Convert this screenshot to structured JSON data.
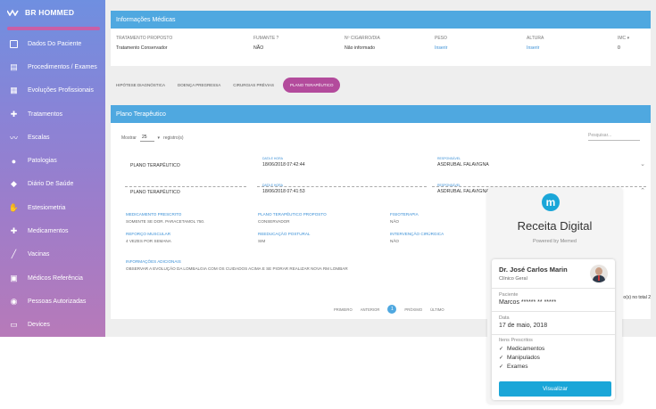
{
  "brand": {
    "name": "BR HOMMED"
  },
  "sidebar": {
    "items": [
      {
        "label": "Dados Do Paciente",
        "icon": "id-card-icon"
      },
      {
        "label": "Procedimentos / Exames",
        "icon": "file-icon"
      },
      {
        "label": "Evoluções Profissionais",
        "icon": "notes-icon"
      },
      {
        "label": "Tratamentos",
        "icon": "bandage-icon"
      },
      {
        "label": "Escalas",
        "icon": "trend-icon"
      },
      {
        "label": "Patologias",
        "icon": "pills-icon"
      },
      {
        "label": "Diário De Saúde",
        "icon": "tag-icon"
      },
      {
        "label": "Estesiometria",
        "icon": "hand-icon"
      },
      {
        "label": "Medicamentos",
        "icon": "bandage-icon"
      },
      {
        "label": "Vacinas",
        "icon": "syringe-icon"
      },
      {
        "label": "Médicos Referência",
        "icon": "badge-icon"
      },
      {
        "label": "Pessoas Autorizadas",
        "icon": "person-icon"
      },
      {
        "label": "Devices",
        "icon": "devices-icon"
      }
    ]
  },
  "info": {
    "title": "Informações Médicas",
    "cols": [
      {
        "label": "TRATAMENTO PROPOSTO",
        "value": "Tratamento Conservador",
        "link": false
      },
      {
        "label": "FUMANTE ?",
        "value": "NÃO",
        "link": false
      },
      {
        "label": "Nº CIGARRO/DIA",
        "value": "Não informado",
        "link": false
      },
      {
        "label": "PESO",
        "value": "Inserir",
        "link": true
      },
      {
        "label": "ALTURA",
        "value": "Inserir",
        "link": true
      },
      {
        "label": "IMC",
        "value": "0",
        "link": false
      }
    ]
  },
  "tabs": [
    "HIPÓTESE DIAGNÓSTICA",
    "DOENÇA PREGRESSA",
    "CIRURGIAS PRÉVIAS",
    "PLANO TERAPÊUTICO"
  ],
  "plan": {
    "title": "Plano Terapêutico",
    "show_prefix": "Mostrar",
    "page_size": "25",
    "show_suffix": "registro(s)",
    "search_placeholder": "Pesquisar...",
    "rows": [
      {
        "title": "PLANO TERAPÊUTICO",
        "date_label": "DATA E HORA",
        "date": "18/06/2018 07:42:44",
        "resp_label": "RESPONSÁVEL",
        "resp": "ASDRUBAL FALAVIGNA",
        "chevron": "⌄"
      },
      {
        "title": "PLANO TERAPÊUTICO",
        "date_label": "DATA E HORA",
        "date": "18/06/2018 07:41:53",
        "resp_label": "RESPONSÁVEL",
        "resp": "ASDRUBAL FALAVIGNA",
        "chevron": "⌃"
      }
    ],
    "details": [
      {
        "label": "MEDICAMENTO PRESCRITO",
        "value": "SOMENTE SE DOR. PARACETAMOL 750."
      },
      {
        "label": "PLANO TERAPÊUTICO PROPOSTO",
        "value": "CONSERVADOR"
      },
      {
        "label": "FISIOTERAPIA",
        "value": "NÃO"
      },
      {
        "label": "REFORÇO MUSCULAR",
        "value": "4 VEZES POR SEMANA"
      },
      {
        "label": "REEDUCAÇÃO POSTURAL",
        "value": "SIM"
      },
      {
        "label": "INTERVENÇÃO CIRÚRGICA",
        "value": "NÃO"
      },
      {
        "label": "INFORMAÇÕES ADICIONAIS",
        "value": "OBSERVAR A EVOLUÇÃO DA LOMBALGIA COM OS CUIDADOS ACIMA E SE PIORAR REALIZAR NOVA RM LOMBAR"
      }
    ],
    "pager": {
      "first": "PRIMEIRO",
      "prev": "ANTERIOR",
      "current": "1",
      "next": "PRÓXIMO",
      "last": "ÚLTIMO"
    },
    "total_text": "o(s) no total 2"
  },
  "receita": {
    "logo_letter": "m",
    "title": "Receita Digital",
    "powered": "Powered by Memed",
    "doctor": "Dr. José Carlos Marin",
    "specialty": "Clínico Geral",
    "patient_label": "Paciente",
    "patient": "Marcos ****** ** *****",
    "date_label": "Data",
    "date": "17 de maio, 2018",
    "items_label": "Itens Prescritos",
    "items": [
      "Medicamentos",
      "Manipulados",
      "Exames"
    ],
    "button": "Visualizar"
  },
  "colors": {
    "accent": "#4fa8e0",
    "tab_active": "#b34b9c",
    "memed": "#1aa6d8"
  }
}
